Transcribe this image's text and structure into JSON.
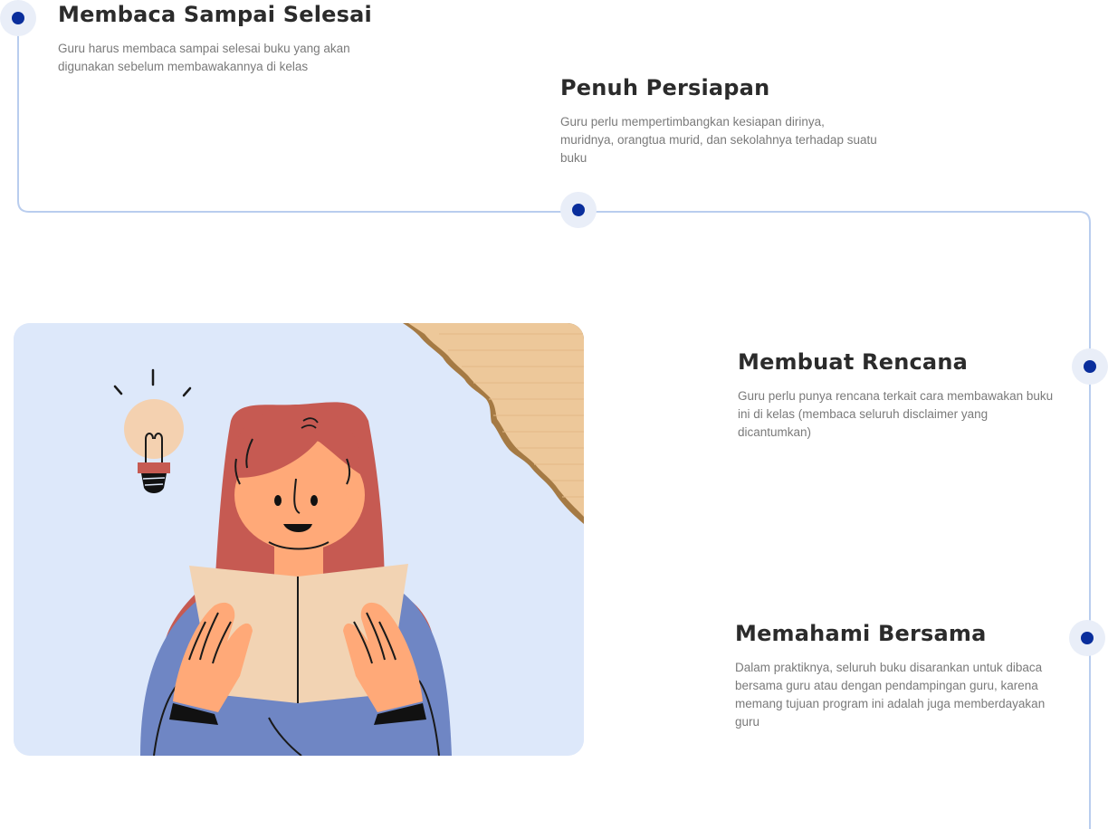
{
  "steps": [
    {
      "title": "Membaca Sampai Selesai",
      "description": "Guru harus membaca sampai selesai buku yang akan digunakan sebelum membawakannya di kelas"
    },
    {
      "title": "Penuh Persiapan",
      "description": "Guru perlu mempertimbangkan kesiapan dirinya, muridnya, orangtua murid, dan sekolahnya terhadap suatu buku"
    },
    {
      "title": "Membuat Rencana",
      "description": "Guru perlu punya rencana terkait cara membawakan buku ini di kelas (membaca seluruh disclaimer yang dicantumkan)"
    },
    {
      "title": "Memahami Bersama",
      "description": "Dalam praktiknya, seluruh buku disarankan untuk dibaca bersama guru atau dengan pendampingan guru, karena memang tujuan program ini adalah juga memberdayakan guru"
    }
  ],
  "colors": {
    "accent": "#0a2e9c",
    "dot_ring": "#e9eef8",
    "line": "#b9cdee",
    "title": "#2b2b2b",
    "text": "#7a7a7a",
    "illustration_bg": "#dde8fa",
    "hair": "#c65a52",
    "skin": "#ffa978",
    "sweater": "#6f86c4",
    "paper": "#f2d3b3",
    "bulb": "#f4d1b0"
  },
  "icons": {
    "timeline_marker": "timeline-dot-icon",
    "lightbulb": "lightbulb-icon"
  }
}
